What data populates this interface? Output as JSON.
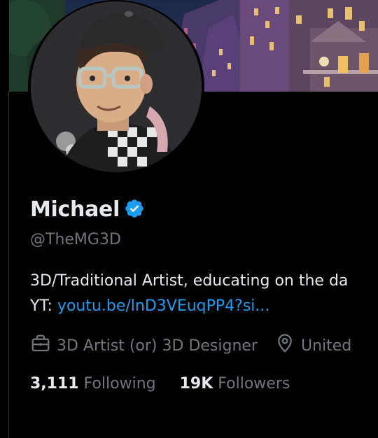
{
  "profile": {
    "display_name": "Michael",
    "handle": "@TheMG3D",
    "verified_icon": "verified-badge-icon",
    "bio_line1": "3D/Traditional Artist, educating on the da",
    "bio_line2_prefix": "YT: ",
    "bio_link": "youtu.be/lnD3VEuqPP4?si...",
    "category": "3D Artist (or) 3D Designer",
    "location": "United",
    "following_count": "3,111",
    "following_label": "Following",
    "followers_count": "19K",
    "followers_label": "Followers"
  },
  "icons": {
    "category": "briefcase-icon",
    "location": "location-pin-icon",
    "verified": "verified-badge-icon"
  },
  "colors": {
    "background": "#000000",
    "text_primary": "#e7e9ea",
    "text_secondary": "#71767b",
    "link": "#1d9bf0",
    "verified": "#1d9bf0"
  }
}
